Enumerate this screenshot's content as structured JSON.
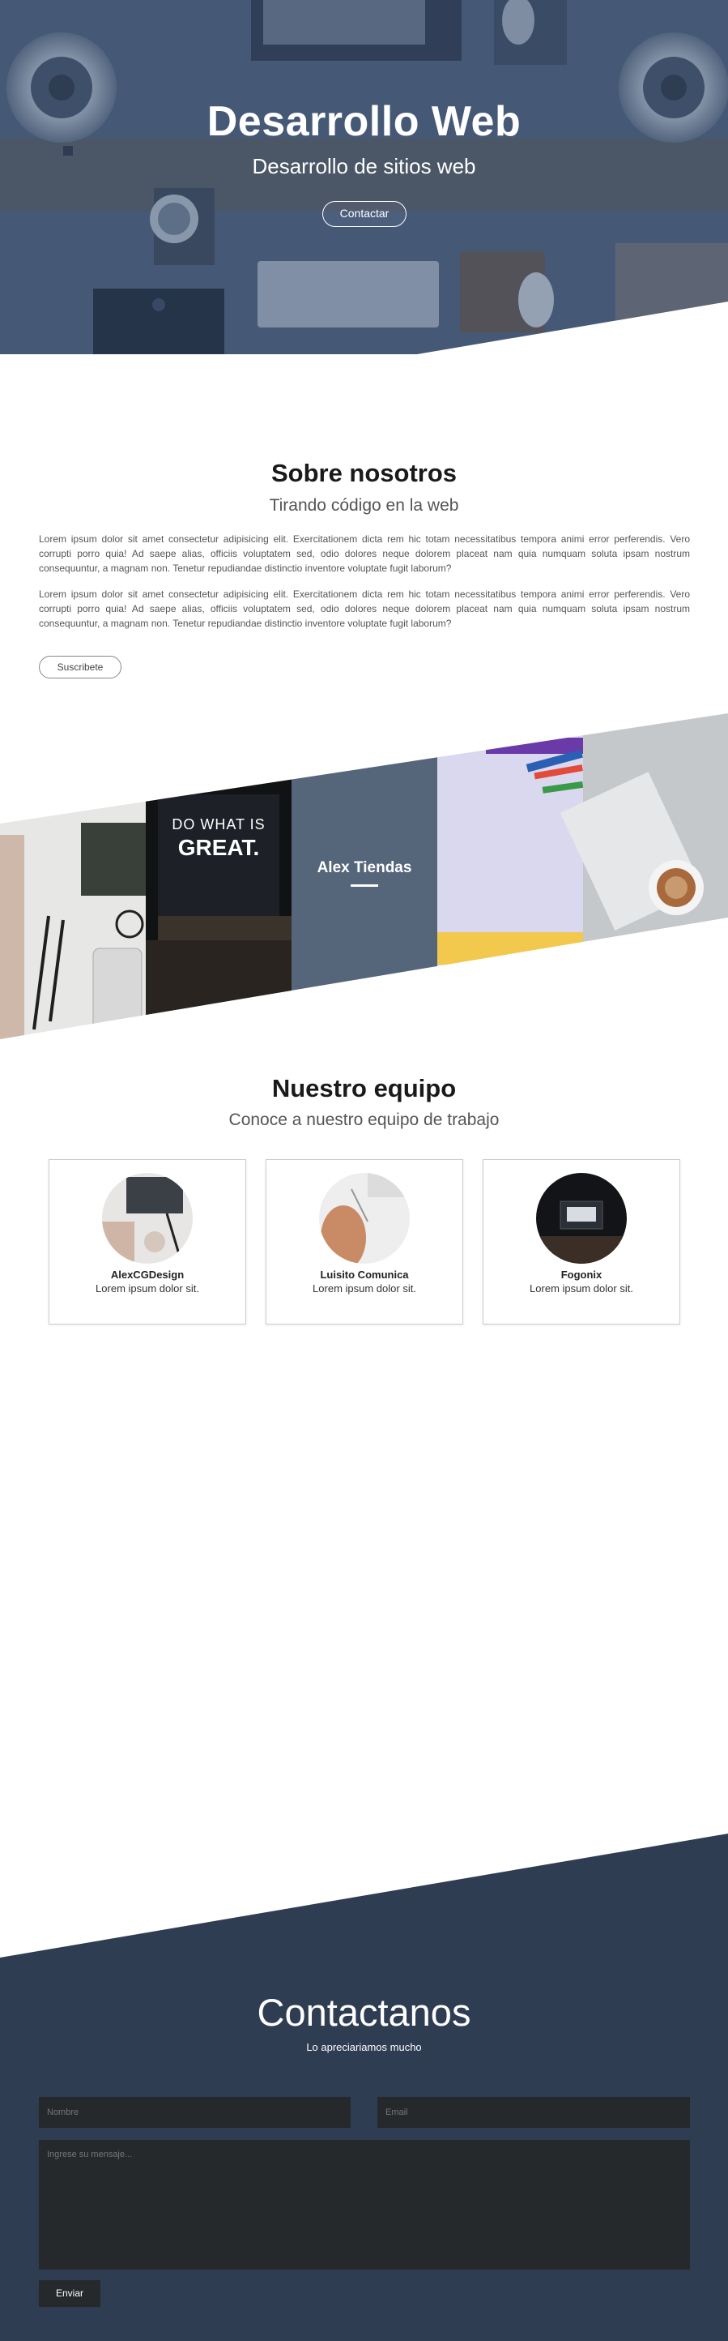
{
  "hero": {
    "title": "Desarrollo Web",
    "subtitle": "Desarrollo de sitios web",
    "cta_label": "Contactar"
  },
  "about": {
    "title": "Sobre nosotros",
    "subtitle": "Tirando código en la web",
    "paragraph_1": "Lorem ipsum dolor sit amet consectetur adipisicing elit. Exercitationem dicta rem hic totam necessitatibus tempora animi error perferendis. Vero corrupti porro quia! Ad saepe alias, officiis voluptatem sed, odio dolores neque dolorem placeat nam quia numquam soluta ipsam nostrum consequuntur, a magnam non. Tenetur repudiandae distinctio inventore voluptate fugit laborum?",
    "paragraph_2": "Lorem ipsum dolor sit amet consectetur adipisicing elit. Exercitationem dicta rem hic totam necessitatibus tempora animi error perferendis. Vero corrupti porro quia! Ad saepe alias, officiis voluptatem sed, odio dolores neque dolorem placeat nam quia numquam soluta ipsam nostrum consequuntur, a magnam non. Tenetur repudiandae distinctio inventore voluptate fugit laborum?",
    "subscribe_label": "Suscribete"
  },
  "gallery": {
    "poster_line_1": "DO WHAT IS",
    "poster_line_2": "GREAT.",
    "center_label": "Alex Tiendas"
  },
  "team": {
    "title": "Nuestro equipo",
    "subtitle": "Conoce a nuestro equipo de trabajo",
    "members": [
      {
        "name": "AlexCGDesign",
        "desc": "Lorem ipsum dolor sit."
      },
      {
        "name": "Luisito Comunica",
        "desc": "Lorem ipsum dolor sit."
      },
      {
        "name": "Fogonix",
        "desc": "Lorem ipsum dolor sit."
      }
    ]
  },
  "contact": {
    "title": "Contactanos",
    "subtitle": "Lo apreciariamos mucho",
    "name_placeholder": "Nombre",
    "email_placeholder": "Email",
    "message_placeholder": "Ingrese su mensaje...",
    "send_label": "Enviar"
  },
  "colors": {
    "hero_overlay": "#3b5070",
    "contact_bg": "#2f3d52",
    "gallery_center": "#55657a",
    "field_bg": "#26292c"
  }
}
